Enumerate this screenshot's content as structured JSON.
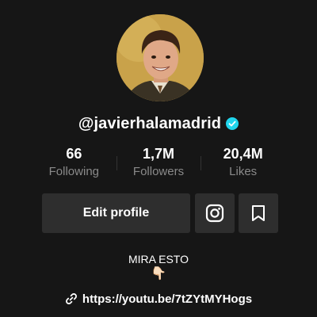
{
  "profile": {
    "username": "@javierhalamadrid",
    "verified": true,
    "avatar_bg": "#c9a24a"
  },
  "stats": [
    {
      "value": "66",
      "label": "Following"
    },
    {
      "value": "1,7M",
      "label": "Followers"
    },
    {
      "value": "20,4M",
      "label": "Likes"
    }
  ],
  "actions": {
    "edit_label": "Edit profile",
    "instagram_icon": "instagram-icon",
    "bookmark_icon": "bookmark-icon"
  },
  "bio": {
    "text": "MIRA ESTO",
    "emoji": "👇🏻"
  },
  "link": {
    "icon": "link-icon",
    "url": "https://youtu.be/7tZYtMYHogs"
  },
  "colors": {
    "background": "#161616",
    "button": "#2e2e2e",
    "verified": "#20d5ec",
    "muted_text": "#8a8a8a"
  }
}
